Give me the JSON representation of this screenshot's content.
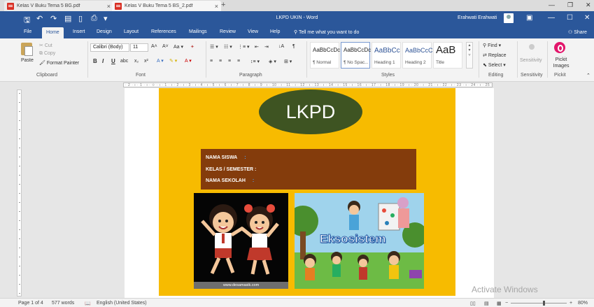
{
  "browser_tabs": [
    {
      "title": "Kelas V Buku Tema 5 BG.pdf",
      "close": "×"
    },
    {
      "title": "Kelas V Buku Tema 5 BS_2.pdf",
      "close": "×"
    }
  ],
  "new_tab": "+",
  "window_title": "LKPD UKIN  -  Word",
  "user_name": "Erahwati Erahwati",
  "ribbon_tabs": [
    "File",
    "Home",
    "Insert",
    "Design",
    "Layout",
    "References",
    "Mailings",
    "Review",
    "View",
    "Help"
  ],
  "active_ribbon_tab": "Home",
  "tell_me": "Tell me what you want to do",
  "share": "Share",
  "clipboard": {
    "paste": "Paste",
    "cut": "Cut",
    "copy": "Copy",
    "format_painter": "Format Painter",
    "label": "Clipboard"
  },
  "font": {
    "name": "Calibri (Body)",
    "size": "11",
    "label": "Font"
  },
  "paragraph": {
    "label": "Paragraph"
  },
  "styles": {
    "label": "Styles",
    "items": [
      {
        "sample": "AaBbCcDc",
        "name": "¶ Normal"
      },
      {
        "sample": "AaBbCcDc",
        "name": "¶ No Spac..."
      },
      {
        "sample": "AaBbCc",
        "name": "Heading 1"
      },
      {
        "sample": "AaBbCcC",
        "name": "Heading 2"
      },
      {
        "sample": "AaB",
        "name": "Title"
      }
    ]
  },
  "editing": {
    "find": "Find",
    "replace": "Replace",
    "select": "Select",
    "label": "Editing"
  },
  "sensitivity": {
    "button": "Sensitivity",
    "label": "Sensitivity"
  },
  "pickit": {
    "button": "Pickit Images",
    "label": "Pickit"
  },
  "ruler_text": "· 2 · ı · 1 · ı · ⟐ · ı · 1 · ı · 2 · ı · 3 · ı · 4 · ı · 5 · ı · 6 · ı · 7 · ı · 8 · ı · 9 · ı · 10 · ı · 11 · ı · 12 · ı · 13 · ı · 14 · ı · 15 · ı · 16 · ı · 17 · ı · 18 · ı · 19 · ı · 20 · ı · 21 · ı · 22 · ı · 23 · ı · 24 · ı · 25 ·",
  "document": {
    "title": "LKPD",
    "fields": [
      {
        "label": "NAMA SISWA",
        "colon": ":"
      },
      {
        "label": "KELAS / SEMESTER :",
        "colon": ""
      },
      {
        "label": "NAMA SEKOLAH",
        "colon": ":"
      }
    ],
    "image1_caption": "www.desamasik.com",
    "image2_title": "Eksosistem"
  },
  "watermark": "Activate Windows",
  "status": {
    "page": "Page 1 of 4",
    "words": "577 words",
    "language": "English (United States)",
    "zoom": "80%",
    "zoom_level_percent": 80
  }
}
